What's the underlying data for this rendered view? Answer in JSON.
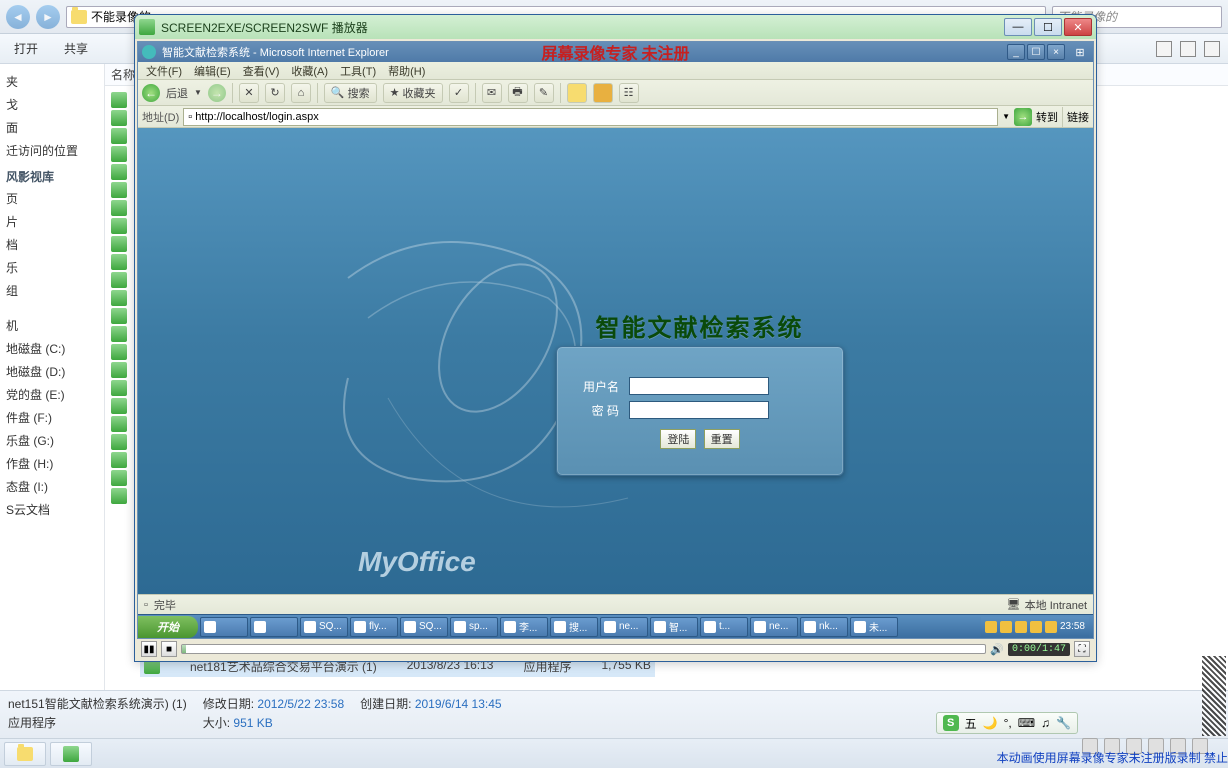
{
  "bg": {
    "breadcrumb": "不能录像的",
    "search_placeholder": "不能录像的",
    "tb2": {
      "open": "打开",
      "share": "共享"
    },
    "sidebar_top": [
      "夹",
      "戈",
      "面",
      "迁访问的位置"
    ],
    "sidebar_lib": "风影视库",
    "sidebar_mid": [
      "页",
      "片",
      "档",
      "乐",
      "组"
    ],
    "sidebar_comp": [
      "机",
      "地磁盘 (C:)",
      "地磁盘 (D:)",
      "党的盘 (E:)",
      "件盘 (F:)",
      "乐盘 (G:)",
      "作盘 (H:)",
      "态盘 (I:)",
      "S云文档"
    ],
    "col_name": "名称",
    "sel_file": {
      "name": "net181艺术品综合交易平台演示 (1)",
      "date": "2013/8/23 16:13",
      "type": "应用程序",
      "size": "1,755 KB"
    }
  },
  "details": {
    "name": "net151智能文献检索系统演示) (1)",
    "type": "应用程序",
    "mod_l": "修改日期:",
    "mod_v": "2012/5/22 23:58",
    "crt_l": "创建日期:",
    "crt_v": "2019/6/14 13:45",
    "sz_l": "大小:",
    "sz_v": "951 KB"
  },
  "player": {
    "title": "SCREEN2EXE/SCREEN2SWF 播放器",
    "time": "0:00/1:47"
  },
  "ie": {
    "title": "智能文献检索系统 - Microsoft Internet Explorer",
    "watermark": "屏幕录像专家  未注册",
    "menu": [
      "文件(F)",
      "编辑(E)",
      "查看(V)",
      "收藏(A)",
      "工具(T)",
      "帮助(H)"
    ],
    "tb": {
      "back": "后退",
      "search": "搜索",
      "fav": "收藏夹"
    },
    "addr_label": "地址(D)",
    "addr_value": "http://localhost/login.aspx",
    "go": "转到",
    "links": "链接",
    "status_done": "完毕",
    "status_zone": "本地 Intranet"
  },
  "login": {
    "title": "智能文献检索系统",
    "user_l": "用户名",
    "user_v": "",
    "pass_l": "密  码",
    "pass_v": "",
    "login_btn": "登陆",
    "reset_btn": "重置",
    "brand": "MyOffice"
  },
  "xp": {
    "start": "开始",
    "tasks": [
      "",
      "",
      "SQ...",
      "fly...",
      "SQ...",
      "sp...",
      "李...",
      "搜...",
      "ne...",
      "智...",
      "t...",
      "ne...",
      "nk...",
      "未..."
    ],
    "clock": "23:58"
  },
  "ime": {
    "label": "五"
  },
  "footer_wm": "本动画使用屏幕录像专家未注册版录制 禁止"
}
